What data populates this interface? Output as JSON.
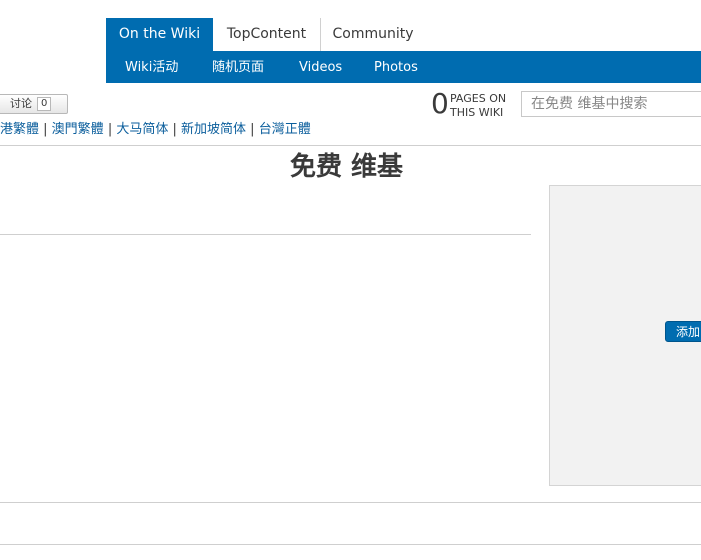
{
  "nav": {
    "tabs": [
      {
        "label": "On the Wiki",
        "active": true
      },
      {
        "label": "TopContent",
        "active": false
      },
      {
        "label": "Community",
        "active": false
      }
    ],
    "subnav": [
      "Wiki活动",
      "随机页面",
      "Videos",
      "Photos"
    ],
    "accent_color": "#006cb0"
  },
  "toolbar": {
    "discuss_label": "讨论",
    "discuss_count": "0"
  },
  "stats": {
    "pages_count": "0",
    "pages_label_line1": "PAGES ON",
    "pages_label_line2": "THIS WIKI"
  },
  "search": {
    "placeholder": "在免费 维基中搜索"
  },
  "variants": [
    "港繁體",
    "澳門繁體",
    "大马简体",
    "新加坡简体",
    "台灣正體"
  ],
  "page": {
    "title": "免费 维基"
  },
  "rail": {
    "add_button_label": "添加"
  }
}
